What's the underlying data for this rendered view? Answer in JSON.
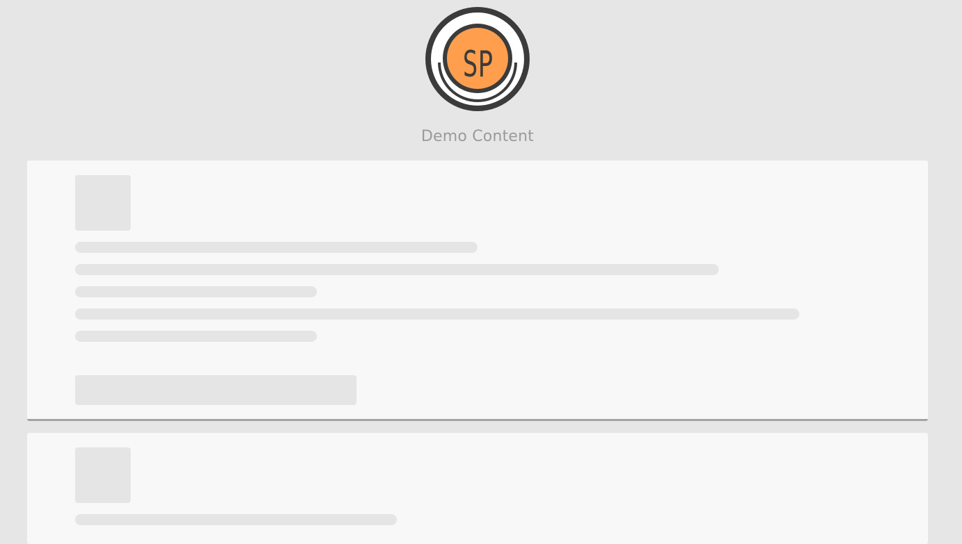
{
  "header": {
    "logo_text": "SP",
    "title": "Demo Content"
  },
  "colors": {
    "page_bg": "#e6e6e6",
    "card_bg": "#f8f8f8",
    "placeholder": "#e5e5e5",
    "logo_orange": "#ff9f4d",
    "logo_dark": "#3b3b3b",
    "title_text": "#9a9a9a"
  },
  "cards": [
    {
      "name": "card-1",
      "state": "loading"
    },
    {
      "name": "card-2",
      "state": "loading"
    }
  ]
}
